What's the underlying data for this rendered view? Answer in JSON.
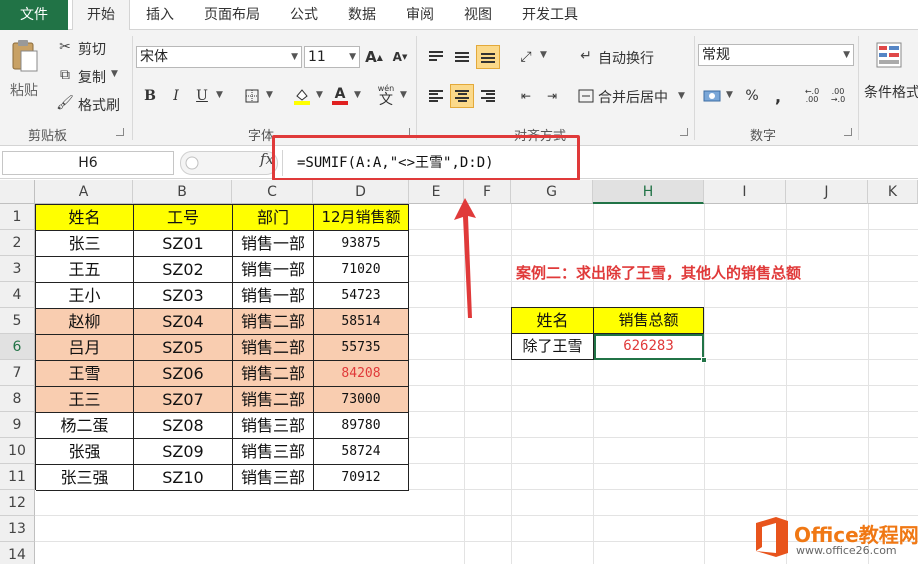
{
  "ribbon": {
    "tabs": [
      "文件",
      "开始",
      "插入",
      "页面布局",
      "公式",
      "数据",
      "审阅",
      "视图",
      "开发工具"
    ],
    "active_tab": "开始",
    "clipboard": {
      "paste": "粘贴",
      "cut": "剪切",
      "copy": "复制",
      "format_painter": "格式刷",
      "group": "剪贴板"
    },
    "font": {
      "name": "宋体",
      "size": "11",
      "group": "字体",
      "bold": "B",
      "italic": "I",
      "underline": "U",
      "wen": "wén",
      "grow": "A",
      "shrink": "A"
    },
    "alignment": {
      "wrap": "自动换行",
      "merge": "合并后居中",
      "group": "对齐方式"
    },
    "number": {
      "format": "常规",
      "group": "数字",
      "percent": "%",
      "comma": ","
    },
    "styles": {
      "conditional": "条件格式"
    }
  },
  "formula_bar": {
    "name_box": "H6",
    "fx": "fx",
    "formula": "=SUMIF(A:A,\"<>王雪\",D:D)"
  },
  "grid": {
    "columns": [
      "A",
      "B",
      "C",
      "D",
      "E",
      "F",
      "G",
      "H",
      "I",
      "J",
      "K"
    ],
    "rows": [
      "1",
      "2",
      "3",
      "4",
      "5",
      "6",
      "7",
      "8",
      "9",
      "10",
      "11",
      "12",
      "13",
      "14"
    ],
    "selected_cell": "H6"
  },
  "table": {
    "headers": [
      "姓名",
      "工号",
      "部门",
      "12月销售额"
    ],
    "rows": [
      [
        "张三",
        "SZ01",
        "销售一部",
        "93875"
      ],
      [
        "王五",
        "SZ02",
        "销售一部",
        "71020"
      ],
      [
        "王小",
        "SZ03",
        "销售一部",
        "54723"
      ],
      [
        "赵柳",
        "SZ04",
        "销售二部",
        "58514"
      ],
      [
        "吕月",
        "SZ05",
        "销售二部",
        "55735"
      ],
      [
        "王雪",
        "SZ06",
        "销售二部",
        "84208"
      ],
      [
        "王三",
        "SZ07",
        "销售二部",
        "73000"
      ],
      [
        "杨二蛋",
        "SZ08",
        "销售三部",
        "89780"
      ],
      [
        "张强",
        "SZ09",
        "销售三部",
        "58724"
      ],
      [
        "张三强",
        "SZ10",
        "销售三部",
        "70912"
      ]
    ]
  },
  "case_title": "案例二：求出除了王雪，其他人的销售总额",
  "result": {
    "headers": [
      "姓名",
      "销售总额"
    ],
    "label": "除了王雪",
    "value": "626283"
  },
  "watermark": {
    "name": "Office教程网",
    "url": "www.office26.com"
  },
  "colors": {
    "excel_green": "#217346",
    "header_yellow": "#ffff00",
    "highlight_peach": "#f9cdb0",
    "annotation_red": "#e03a3a",
    "watermark_orange": "#f07814"
  }
}
